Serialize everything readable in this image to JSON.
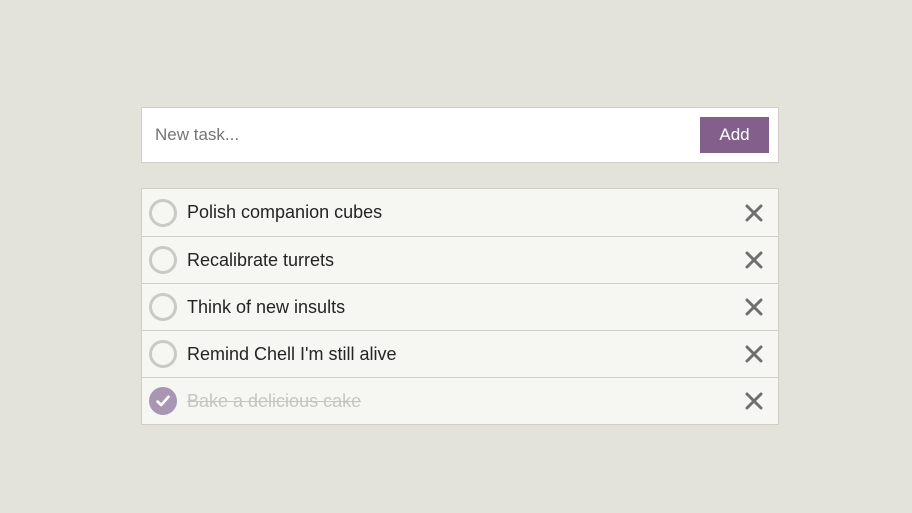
{
  "new_task": {
    "placeholder": "New task...",
    "value": "",
    "add_label": "Add"
  },
  "tasks": [
    {
      "label": "Polish companion cubes",
      "done": false
    },
    {
      "label": "Recalibrate turrets",
      "done": false
    },
    {
      "label": "Think of new insults",
      "done": false
    },
    {
      "label": "Remind Chell I'm still alive",
      "done": false
    },
    {
      "label": "Bake a delicious cake",
      "done": true
    }
  ],
  "icons": {
    "check": "check-icon",
    "remove": "close-icon"
  },
  "colors": {
    "background": "#e3e3dc",
    "accent": "#83608b",
    "done_check": "#a996b2",
    "remove_icon": "#6f6f6f"
  }
}
